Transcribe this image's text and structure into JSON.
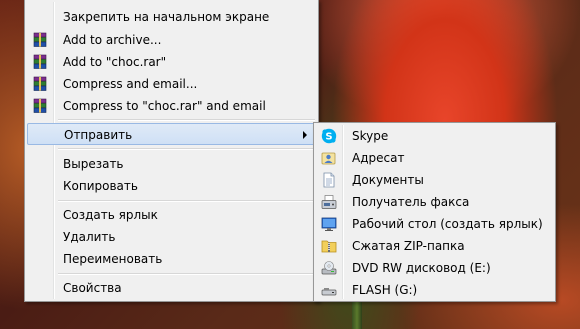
{
  "context_menu": {
    "items": [
      {
        "label": "Закрепить на начальном экране",
        "icon": "none"
      },
      {
        "label": "Add to archive...",
        "icon": "winrar-icon"
      },
      {
        "label": "Add to \"choc.rar\"",
        "icon": "winrar-icon"
      },
      {
        "label": "Compress and email...",
        "icon": "winrar-icon"
      },
      {
        "label": "Compress to \"choc.rar\" and email",
        "icon": "winrar-icon"
      },
      {
        "label": "Отправить",
        "icon": "none",
        "highlighted": true,
        "submenu": true
      },
      {
        "label": "Вырезать",
        "icon": "none"
      },
      {
        "label": "Копировать",
        "icon": "none"
      },
      {
        "label": "Создать ярлык",
        "icon": "none"
      },
      {
        "label": "Удалить",
        "icon": "none"
      },
      {
        "label": "Переименовать",
        "icon": "none"
      },
      {
        "label": "Свойства",
        "icon": "none"
      }
    ]
  },
  "sendto_menu": {
    "items": [
      {
        "label": "Skype",
        "icon": "skype-icon"
      },
      {
        "label": "Адресат",
        "icon": "contact-icon"
      },
      {
        "label": "Документы",
        "icon": "documents-icon"
      },
      {
        "label": "Получатель факса",
        "icon": "fax-icon"
      },
      {
        "label": "Рабочий стол (создать ярлык)",
        "icon": "desktop-icon"
      },
      {
        "label": "Сжатая ZIP-папка",
        "icon": "zip-folder-icon"
      },
      {
        "label": "DVD RW дисковод (E:)",
        "icon": "dvd-drive-icon"
      },
      {
        "label": "FLASH (G:)",
        "icon": "usb-drive-icon"
      }
    ]
  },
  "colors": {
    "menu_bg": "#f0f0f0",
    "highlight_bg": "#cfe0f5",
    "highlight_border": "#99b9e4",
    "skype_blue": "#00aff0"
  }
}
